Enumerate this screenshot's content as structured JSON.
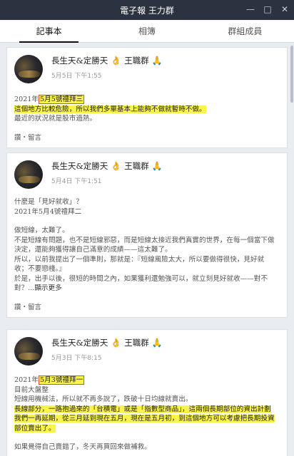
{
  "window": {
    "title": "電子報 王力群",
    "minimize": "—",
    "maximize": "□",
    "close": "✕"
  },
  "tabs": [
    {
      "label": "記事本",
      "active": true
    },
    {
      "label": "相簿",
      "active": false
    },
    {
      "label": "群組成員",
      "active": false
    }
  ],
  "posts": [
    {
      "author": "長生天&定勝天",
      "author_emoji": "👌",
      "name": "王職群",
      "name_emoji": "🙏",
      "time": "5月5日 下午1:55",
      "prefix": "2021年",
      "date_hl": "5月5號禮拜三",
      "line2": "這個地方比較危險，所以我們多單基本上能夠不做就暫時不做。",
      "line3": "最近的狀況就是股市過熱。",
      "footer": "讚・留言"
    },
    {
      "author": "長生天&定勝天",
      "author_emoji": "👌",
      "name": "王職群",
      "name_emoji": "🙏",
      "time": "5月4日 下午1:51",
      "l1": "什麼是「見好就收」？",
      "l2": "2021年5月4號禮拜二",
      "l3": "做短線，太難了。",
      "l4": "不是短線有問題，也不是短線邪惡，而是短線太接近我們真實的世界，在每一個當下做",
      "l5": "決定，還能夠獲得讓自己滿意的成績——這太難了。",
      "l6": "所以，以前我提出了一個準則，那就是：『短線風險太大，所以要做得很快，見好就",
      "l7": "收；不要戀棧。』",
      "l8": "於是，出手以後，很短的時間之內，如果獲利還勉強可以，就立刻見好就收——對不",
      "l9": "對？...",
      "readmore": "顯示更多",
      "footer": "讚・留言"
    },
    {
      "author": "長生天&定勝天",
      "author_emoji": "👌",
      "name": "王職群",
      "name_emoji": "🙏",
      "time": "5月3日 下午8:15",
      "prefix": "2021年",
      "date_hl": "5月3號禮拜一",
      "l2": "目前大盤整",
      "l3": "短線用機械法，所以就不再多說了，跌破十日均線就賣出。",
      "l4": "長線部分，一路抱過來的「台積電」或是「指數型商品」，這兩個長期部位的資出計劃",
      "l5": "我們一再延期，從三月延到現在五月，現在是五月初，到這個地方可以考慮把長期投資",
      "l6": "部位賣出了。",
      "l7": "如果覺得自己賣錯了，冬天再買回來做補救。"
    }
  ]
}
